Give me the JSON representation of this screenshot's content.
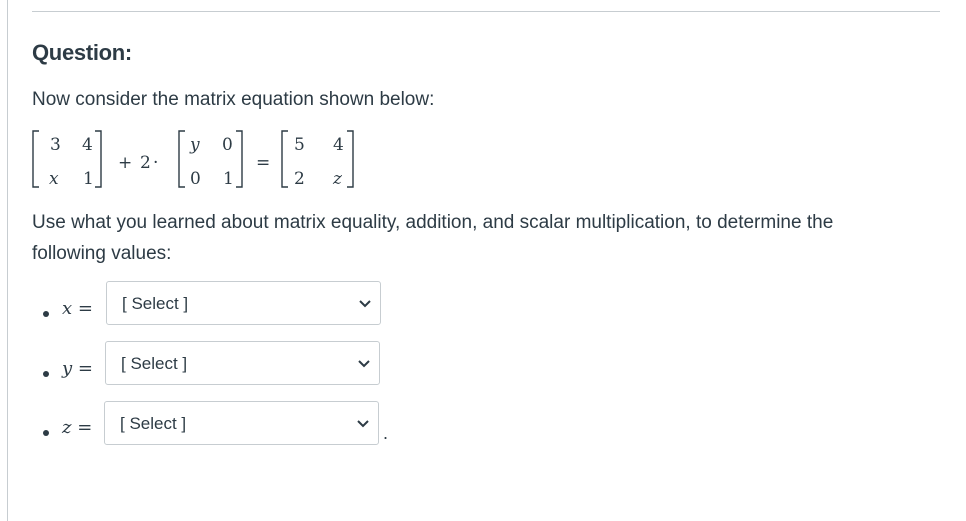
{
  "question": {
    "title": "Question:",
    "prompt": "Now consider the matrix equation shown below:",
    "instructions": "Use what you learned about matrix equality, addition, and scalar multiplication, to determine the following values:"
  },
  "equation": {
    "matrix_a": [
      [
        "3",
        "4"
      ],
      [
        "x",
        "1"
      ]
    ],
    "operator_plus": "+",
    "scalar": "2",
    "operator_dot": "·",
    "matrix_b": [
      [
        "y",
        "0"
      ],
      [
        "0",
        "1"
      ]
    ],
    "operator_equals": "=",
    "matrix_c": [
      [
        "5",
        "4"
      ],
      [
        "2",
        "z"
      ]
    ]
  },
  "answers": [
    {
      "variable": "x",
      "equals": "=",
      "selected": "[ Select ]"
    },
    {
      "variable": "y",
      "equals": "=",
      "selected": "[ Select ]"
    },
    {
      "variable": "z",
      "equals": "=",
      "selected": "[ Select ]"
    }
  ],
  "trailing_punctuation": ".",
  "icons": {
    "dropdown": "chevron-down-icon"
  }
}
